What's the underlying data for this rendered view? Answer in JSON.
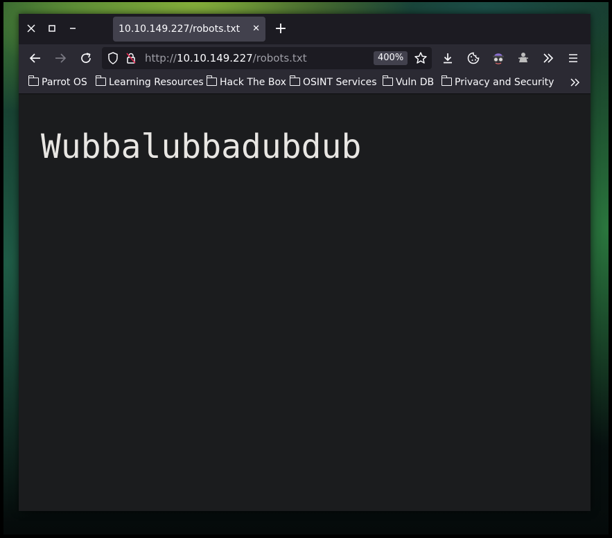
{
  "window": {
    "controls": {
      "close_icon": "close-icon",
      "maximize_icon": "maximize-icon",
      "minimize_icon": "minimize-icon"
    }
  },
  "tab": {
    "title": "10.10.149.227/robots.txt",
    "close_glyph": "✕",
    "new_tab_glyph": "+"
  },
  "navbar": {
    "url_scheme": "http://",
    "url_host": "10.10.149.227",
    "url_path": "/robots.txt",
    "zoom": "400%"
  },
  "bookmarks": {
    "items": [
      {
        "label": "Parrot OS"
      },
      {
        "label": "Learning Resources"
      },
      {
        "label": "Hack The Box"
      },
      {
        "label": "OSINT Services"
      },
      {
        "label": "Vuln DB"
      },
      {
        "label": "Privacy and Security"
      }
    ],
    "more_glyph": "»"
  },
  "page": {
    "text": "Wubbalubbadubdub"
  },
  "colors": {
    "tabbar_bg": "#1c1b22",
    "toolbar_bg": "#2b2a33",
    "active_tab_bg": "#42414d",
    "content_bg": "#1b1c1e",
    "content_text": "#e8e6e3",
    "insecure_lock_accent": "#e22850"
  }
}
